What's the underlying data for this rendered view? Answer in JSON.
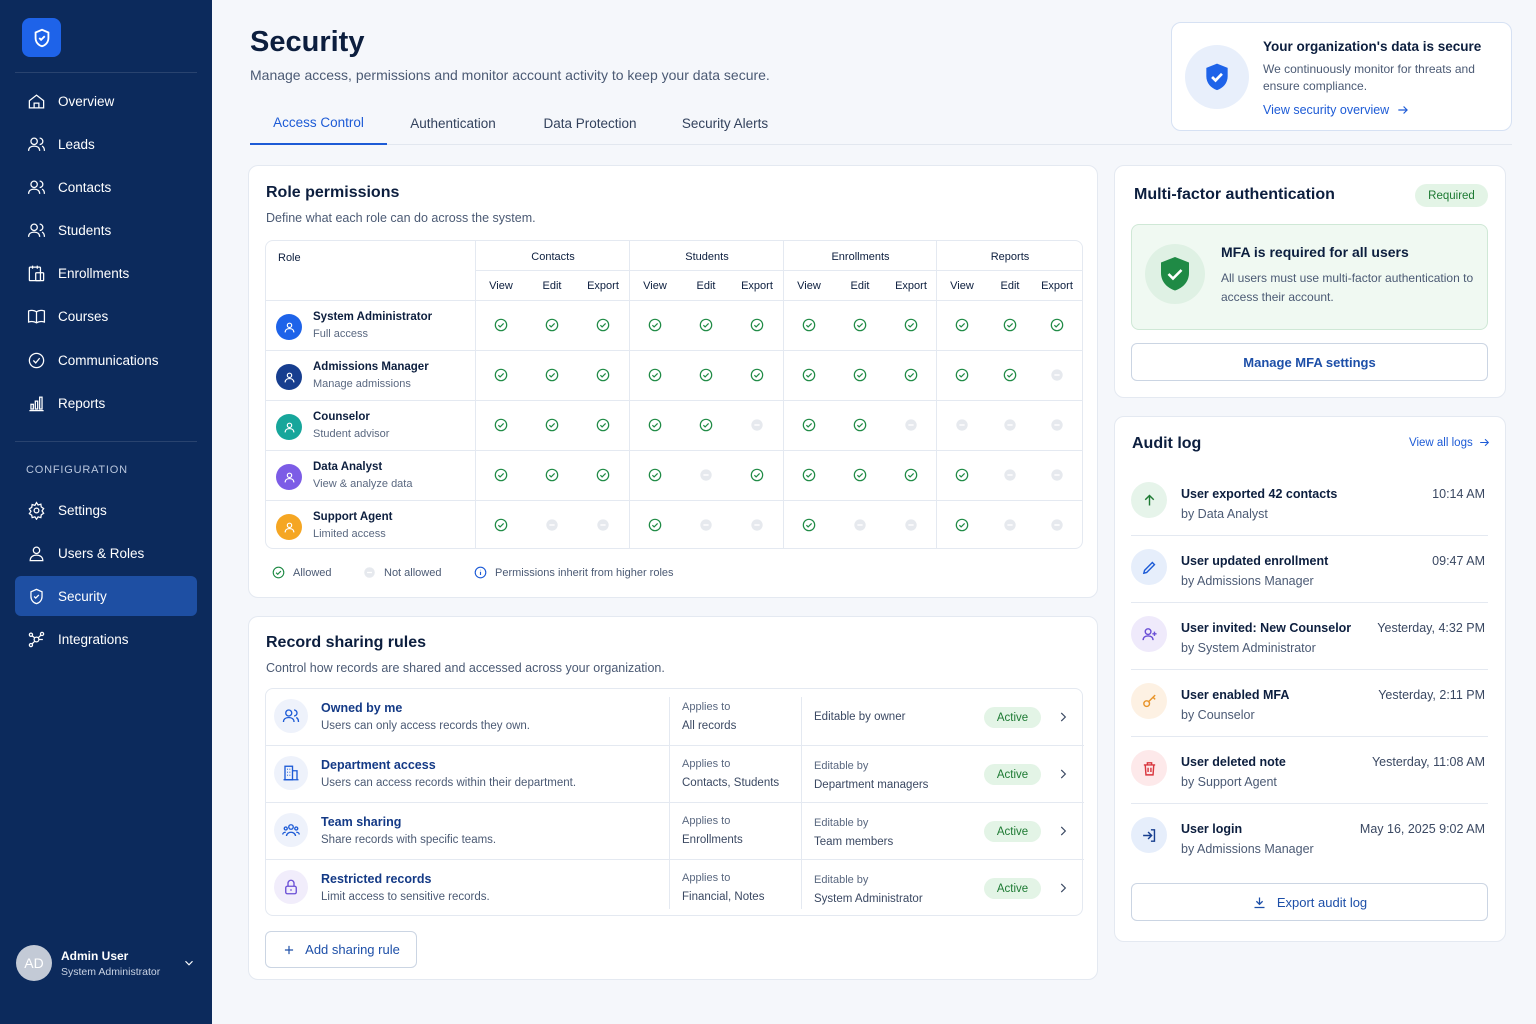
{
  "sidebar": {
    "items": [
      {
        "label": "Overview",
        "icon": "home-icon"
      },
      {
        "label": "Leads",
        "icon": "leads-icon"
      },
      {
        "label": "Contacts",
        "icon": "contacts-icon"
      },
      {
        "label": "Students",
        "icon": "students-icon"
      },
      {
        "label": "Enrollments",
        "icon": "enrollments-icon"
      },
      {
        "label": "Courses",
        "icon": "courses-icon"
      },
      {
        "label": "Communications",
        "icon": "communications-icon"
      },
      {
        "label": "Reports",
        "icon": "reports-icon"
      }
    ],
    "section_label": "CONFIGURATION",
    "config_items": [
      {
        "label": "Settings",
        "icon": "gear-icon"
      },
      {
        "label": "Users & Roles",
        "icon": "user-icon"
      },
      {
        "label": "Security",
        "icon": "shield-icon",
        "active": true
      },
      {
        "label": "Integrations",
        "icon": "integrations-icon"
      }
    ],
    "user": {
      "initials": "AD",
      "name": "Admin User",
      "role": "System Administrator"
    }
  },
  "header": {
    "title": "Security",
    "subtitle": "Manage access, permissions and monitor account activity to keep your data secure.",
    "tabs": [
      "Access Control",
      "Authentication",
      "Data Protection",
      "Security Alerts"
    ],
    "active_tab": "Access Control"
  },
  "secure_card": {
    "title": "Your organization's data is secure",
    "desc": "We continuously monitor for threats and ensure compliance.",
    "link": "View security overview"
  },
  "roles": {
    "title": "Role permissions",
    "subtitle": "Define what each role can do across the system.",
    "role_header": "Role",
    "groups": [
      "Contacts",
      "Students",
      "Enrollments",
      "Reports"
    ],
    "cols": [
      "View",
      "Edit",
      "Export"
    ],
    "rows": [
      {
        "name": "System Administrator",
        "desc": "Full access",
        "color": "#1e63e9",
        "perms": [
          1,
          1,
          1,
          1,
          1,
          1,
          1,
          1,
          1,
          1,
          1,
          1
        ]
      },
      {
        "name": "Admissions Manager",
        "desc": "Manage admissions",
        "color": "#173e8f",
        "perms": [
          1,
          1,
          1,
          1,
          1,
          1,
          1,
          1,
          1,
          1,
          1,
          0
        ]
      },
      {
        "name": "Counselor",
        "desc": "Student advisor",
        "color": "#17a69b",
        "perms": [
          1,
          1,
          1,
          1,
          1,
          0,
          1,
          1,
          0,
          0,
          0,
          0
        ]
      },
      {
        "name": "Data Analyst",
        "desc": "View & analyze data",
        "color": "#7c5ce6",
        "perms": [
          1,
          1,
          1,
          1,
          0,
          1,
          1,
          1,
          1,
          1,
          0,
          0
        ]
      },
      {
        "name": "Support Agent",
        "desc": "Limited access",
        "color": "#f5a623",
        "perms": [
          1,
          0,
          0,
          1,
          0,
          0,
          1,
          0,
          0,
          1,
          0,
          0
        ]
      }
    ],
    "legend": {
      "allowed": "Allowed",
      "not_allowed": "Not allowed",
      "note": "Permissions inherit from higher roles"
    }
  },
  "sharing": {
    "title": "Record sharing rules",
    "subtitle": "Control how records are shared and accessed across your organization.",
    "rules": [
      {
        "name": "Owned by me",
        "desc": "Users can only access records they own.",
        "applies_label": "Applies to",
        "applies": "All records",
        "editable_label": "",
        "editable": "Editable by owner",
        "status": "Active",
        "icon": "user-icon"
      },
      {
        "name": "Department access",
        "desc": "Users can access records within their department.",
        "applies_label": "Applies to",
        "applies": "Contacts, Students",
        "editable_label": "Editable by",
        "editable": "Department managers",
        "status": "Active",
        "icon": "building-icon"
      },
      {
        "name": "Team sharing",
        "desc": "Share records with specific teams.",
        "applies_label": "Applies to",
        "applies": "Enrollments",
        "editable_label": "Editable by",
        "editable": "Team members",
        "status": "Active",
        "icon": "team-icon"
      },
      {
        "name": "Restricted records",
        "desc": "Limit access to sensitive records.",
        "applies_label": "Applies to",
        "applies": "Financial, Notes",
        "editable_label": "Editable by",
        "editable": "System Administrator",
        "status": "Active",
        "icon": "lock-icon"
      }
    ],
    "add_button": "Add sharing rule"
  },
  "mfa": {
    "title": "Multi-factor authentication",
    "badge": "Required",
    "box_title": "MFA is required for all users",
    "box_desc": "All users must use multi-factor authentication to access their account.",
    "button": "Manage MFA settings"
  },
  "audit": {
    "title": "Audit log",
    "view_all": "View all logs",
    "entries": [
      {
        "action": "User exported 42 contacts",
        "by": "by Data Analyst",
        "time": "10:14 AM",
        "icon": "arrow-up-icon",
        "bg": "#e6f4ea",
        "fg": "#1d7a33"
      },
      {
        "action": "User updated enrollment",
        "by": "by Admissions Manager",
        "time": "09:47 AM",
        "icon": "pencil-icon",
        "bg": "#e6eefb",
        "fg": "#1d5bd6"
      },
      {
        "action": "User invited: New Counselor",
        "by": "by System Administrator",
        "time": "Yesterday, 4:32 PM",
        "icon": "user-plus-icon",
        "bg": "#efeafb",
        "fg": "#6a4fd6"
      },
      {
        "action": "User enabled MFA",
        "by": "by Counselor",
        "time": "Yesterday, 2:11 PM",
        "icon": "key-icon",
        "bg": "#fdf1e3",
        "fg": "#e8942a"
      },
      {
        "action": "User deleted note",
        "by": "by Support Agent",
        "time": "Yesterday, 11:08 AM",
        "icon": "trash-icon",
        "bg": "#fde9ea",
        "fg": "#d9363e"
      },
      {
        "action": "User login",
        "by": "by Admissions Manager",
        "time": "May 16, 2025 9:02 AM",
        "icon": "login-icon",
        "bg": "#e6eefb",
        "fg": "#173e8f"
      }
    ],
    "export_button": "Export audit log"
  }
}
